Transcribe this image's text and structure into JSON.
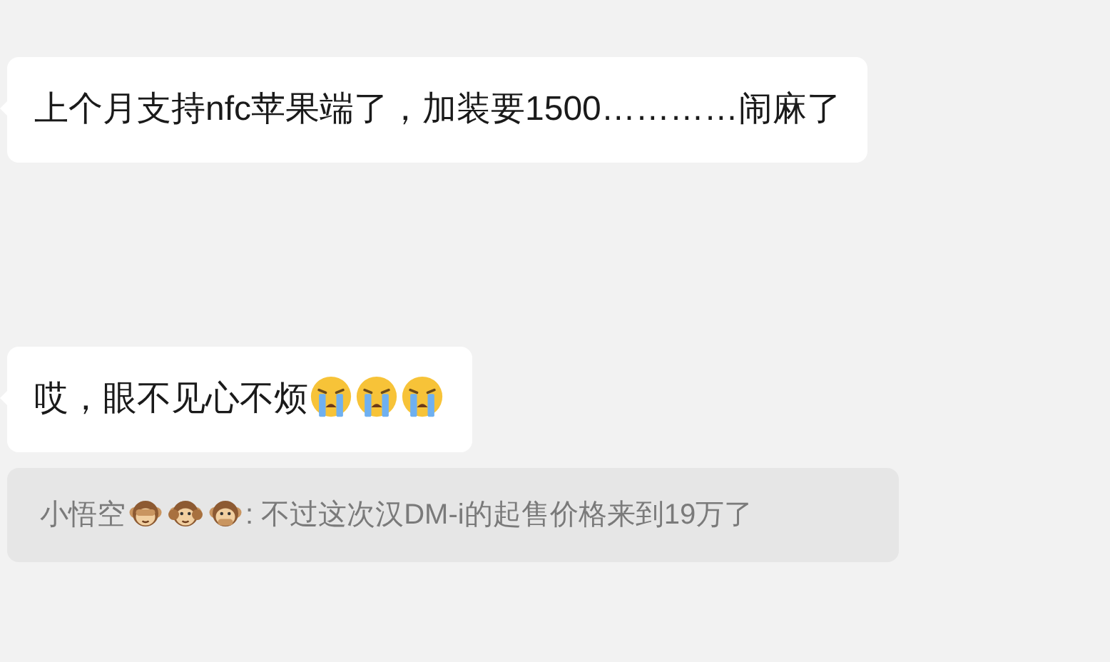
{
  "messages": [
    {
      "kind": "bubble",
      "parts": [
        {
          "kind": "text",
          "text": "上个月支持nfc苹果端了，加装要1500…………闹麻了"
        }
      ]
    },
    {
      "kind": "bubble",
      "parts": [
        {
          "kind": "text",
          "text": "哎，眼不见心不烦"
        },
        {
          "kind": "crying"
        },
        {
          "kind": "crying"
        },
        {
          "kind": "crying"
        }
      ]
    },
    {
      "kind": "quote",
      "parts": [
        {
          "kind": "text",
          "text": "小悟空"
        },
        {
          "kind": "monkey-eyes"
        },
        {
          "kind": "monkey-ears"
        },
        {
          "kind": "monkey-mouth"
        },
        {
          "kind": "text",
          "text": ": 不过这次汉DM-i的起售价格来到19万了"
        }
      ]
    }
  ]
}
